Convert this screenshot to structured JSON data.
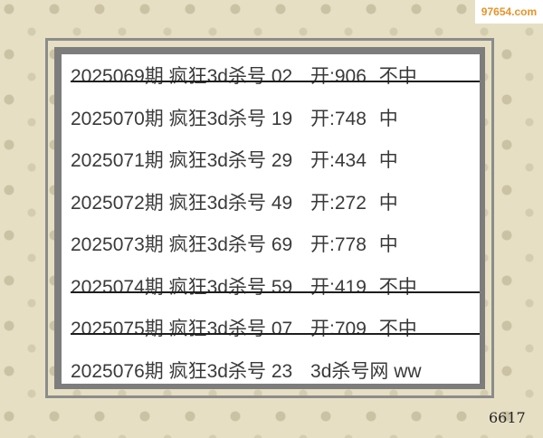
{
  "watermark": "97654.com",
  "page_number": "6617",
  "rows": [
    {
      "period": "2025069期",
      "title": "疯狂3d杀号",
      "kill": "02",
      "result": "开:906",
      "status": "不中",
      "missed": true
    },
    {
      "period": "2025070期",
      "title": "疯狂3d杀号",
      "kill": "19",
      "result": "开:748",
      "status": "中",
      "missed": false
    },
    {
      "period": "2025071期",
      "title": "疯狂3d杀号",
      "kill": "29",
      "result": "开:434",
      "status": "中",
      "missed": false
    },
    {
      "period": "2025072期",
      "title": "疯狂3d杀号",
      "kill": "49",
      "result": "开:272",
      "status": "中",
      "missed": false
    },
    {
      "period": "2025073期",
      "title": "疯狂3d杀号",
      "kill": "69",
      "result": "开:778",
      "status": "中",
      "missed": false
    },
    {
      "period": "2025074期",
      "title": "疯狂3d杀号",
      "kill": "59",
      "result": "开:419",
      "status": "不中",
      "missed": true
    },
    {
      "period": "2025075期",
      "title": "疯狂3d杀号",
      "kill": "07",
      "result": "开:709",
      "status": "不中",
      "missed": true
    },
    {
      "period": "2025076期",
      "title": "疯狂3d杀号",
      "kill": "23",
      "result": "3d杀号网 ww",
      "status": "",
      "missed": false
    }
  ]
}
